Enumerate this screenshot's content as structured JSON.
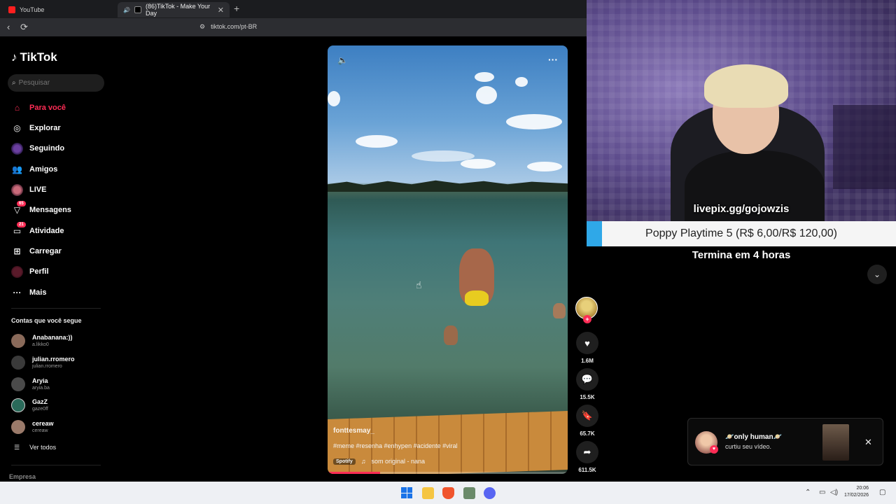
{
  "browser": {
    "tabs": [
      {
        "title": "YouTube"
      },
      {
        "title": "(86)TikTok - Make Your Day"
      }
    ],
    "new_tab": "+",
    "url": "tiktok.com/pt-BR"
  },
  "sidebar": {
    "logo": "TikTok",
    "search_placeholder": "Pesquisar",
    "menu": [
      {
        "label": "Para você",
        "icon": "home-icon"
      },
      {
        "label": "Explorar",
        "icon": "compass-icon"
      },
      {
        "label": "Seguindo",
        "icon": "following-icon"
      },
      {
        "label": "Amigos",
        "icon": "friends-icon"
      },
      {
        "label": "LIVE",
        "icon": "live-icon"
      },
      {
        "label": "Mensagens",
        "icon": "message-icon",
        "badge": "65"
      },
      {
        "label": "Atividade",
        "icon": "activity-icon",
        "badge": "21"
      },
      {
        "label": "Carregar",
        "icon": "upload-icon"
      },
      {
        "label": "Perfil",
        "icon": "profile-icon"
      },
      {
        "label": "Mais",
        "icon": "more-icon"
      }
    ],
    "following_title": "Contas que você segue",
    "following": [
      {
        "name": "Anabanana:))",
        "handle": "a.likko0"
      },
      {
        "name": "julian.rromero",
        "handle": "julian.rromero"
      },
      {
        "name": "Aryia",
        "handle": "aryia.ba"
      },
      {
        "name": "GazZ",
        "handle": "gaze0ff"
      },
      {
        "name": "cereaw",
        "handle": "cereaw"
      }
    ],
    "see_all": "Ver todos",
    "footer": "Empresa"
  },
  "video": {
    "author": "fonttesmay_",
    "caption": "#meme #resenha #enhypen #acidente #viral",
    "music_source": "Spotify",
    "music": "som original - nana",
    "progress": 0.22
  },
  "actions": {
    "likes": "1.6M",
    "comments": "15.5K",
    "saves": "65.7K",
    "shares": "611.5K"
  },
  "stream_overlay": {
    "livepix": "livepix.gg/gojowzis",
    "goal_text": "Poppy Playtime 5 (R$ 6,00/R$ 120,00)",
    "goal_progress": 0.05,
    "ends": "Termina em 4 horas"
  },
  "notification": {
    "user": "🪐only human🪐",
    "text": "curtiu seu vídeo."
  },
  "taskbar": {
    "time": "20:06",
    "date": "17/02/2026"
  },
  "colors": {
    "accent": "#fe2c55",
    "goal_bar": "#2fa8e8"
  }
}
